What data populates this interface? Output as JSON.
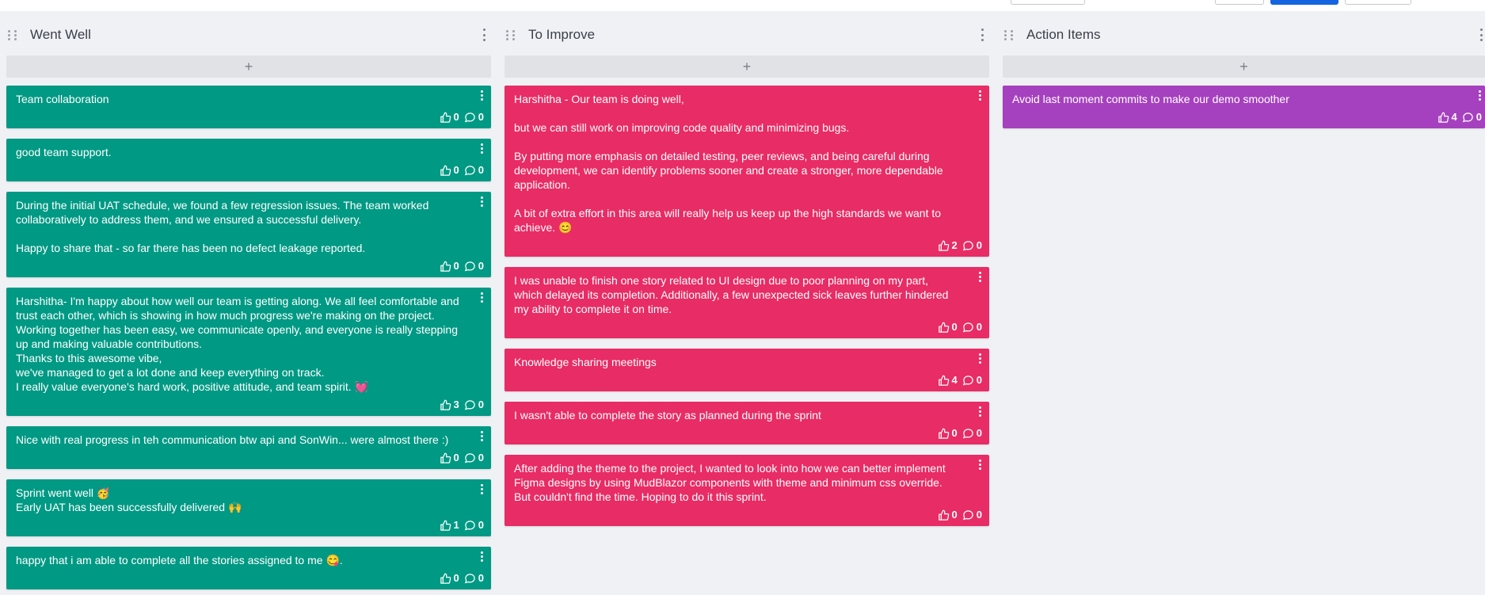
{
  "columns": [
    {
      "title": "Went Well",
      "add_label": "+",
      "color": "#009984",
      "cards": [
        {
          "text": "Team collaboration",
          "likes": "0",
          "comments": "0"
        },
        {
          "text": "good team support.",
          "likes": "0",
          "comments": "0"
        },
        {
          "text": "During the initial UAT schedule, we found a few regression issues. The team worked collaboratively to address them, and we ensured a successful delivery.\n\nHappy to share that - so far there has been no defect leakage reported.",
          "likes": "0",
          "comments": "0"
        },
        {
          "text": "Harshitha- I'm happy about how well our team is getting along. We all feel comfortable and trust each other, which is showing in how much progress we're making on the project. Working together has been easy, we communicate openly, and everyone is really stepping up and making valuable contributions.\nThanks to this awesome vibe,\nwe've managed to get a lot done and keep everything on track.\nI really value everyone's hard work, positive attitude, and team spirit. 💓",
          "likes": "3",
          "comments": "0"
        },
        {
          "text": "Nice with real progress in teh communication btw api and SonWin... were almost there :)",
          "likes": "0",
          "comments": "0"
        },
        {
          "text": "Sprint went well 🥳\nEarly UAT has been successfully delivered 🙌",
          "likes": "1",
          "comments": "0"
        },
        {
          "text": "happy that i am able to complete all the stories assigned to me 😋.",
          "likes": "0",
          "comments": "0"
        }
      ]
    },
    {
      "title": "To Improve",
      "add_label": "+",
      "color": "#e82c65",
      "cards": [
        {
          "text": "Harshitha - Our team is doing well,\n\nbut we can still work on improving code quality and minimizing bugs.\n\nBy putting more emphasis on detailed testing, peer reviews, and being careful during development, we can identify problems sooner and create a stronger, more dependable application.\n\nA bit of extra effort in this area will really help us keep up the high standards we want to achieve. 😊",
          "likes": "2",
          "comments": "0"
        },
        {
          "text": "I was unable to finish one story related to UI design due to poor planning on my part, which delayed its completion. Additionally, a few unexpected sick leaves further hindered my ability to complete it on time.",
          "likes": "0",
          "comments": "0"
        },
        {
          "text": "Knowledge sharing meetings",
          "likes": "4",
          "comments": "0"
        },
        {
          "text": "I wasn't able to complete the story as planned during the sprint",
          "likes": "0",
          "comments": "0"
        },
        {
          "text": "After adding the theme to the project, I wanted to look into how we can better implement Figma designs by using MudBlazor components with theme and minimum css override. But couldn't find the time. Hoping to do it this sprint.",
          "likes": "0",
          "comments": "0"
        }
      ]
    },
    {
      "title": "Action Items",
      "add_label": "+",
      "color": "#a541be",
      "cards": [
        {
          "text": "Avoid last moment commits to make our demo smoother",
          "likes": "4",
          "comments": "0"
        }
      ]
    }
  ]
}
